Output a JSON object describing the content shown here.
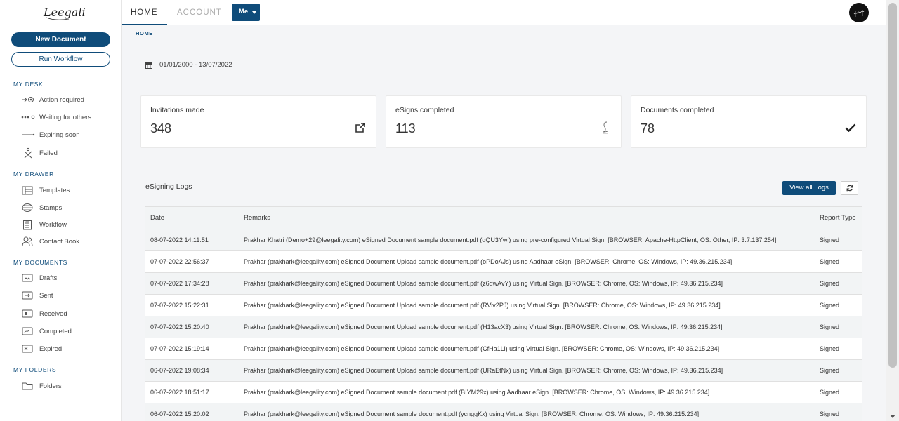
{
  "brand": {
    "logo_text": "Leegality"
  },
  "sidebar": {
    "new_document": "New Document",
    "run_workflow": "Run Workflow",
    "sections": [
      {
        "title": "MY DESK",
        "items": [
          {
            "label": "Action required",
            "icon": "action-required-icon"
          },
          {
            "label": "Waiting for others",
            "icon": "waiting-icon"
          },
          {
            "label": "Expiring soon",
            "icon": "expiring-icon"
          },
          {
            "label": "Failed",
            "icon": "failed-icon"
          }
        ]
      },
      {
        "title": "MY DRAWER",
        "items": [
          {
            "label": "Templates",
            "icon": "templates-icon"
          },
          {
            "label": "Stamps",
            "icon": "stamps-icon"
          },
          {
            "label": "Workflow",
            "icon": "workflow-icon"
          },
          {
            "label": "Contact Book",
            "icon": "contact-book-icon"
          }
        ]
      },
      {
        "title": "MY DOCUMENTS",
        "items": [
          {
            "label": "Drafts",
            "icon": "drafts-icon"
          },
          {
            "label": "Sent",
            "icon": "sent-icon"
          },
          {
            "label": "Received",
            "icon": "received-icon"
          },
          {
            "label": "Completed",
            "icon": "completed-icon"
          },
          {
            "label": "Expired",
            "icon": "expired-icon"
          }
        ]
      },
      {
        "title": "MY FOLDERS",
        "items": [
          {
            "label": "Folders",
            "icon": "folder-icon"
          }
        ]
      }
    ]
  },
  "topbar": {
    "tabs": [
      "HOME",
      "ACCOUNT"
    ],
    "me_label": "Me"
  },
  "breadcrumb": "HOME",
  "date_range": "01/01/2000 - 13/07/2022",
  "stats": [
    {
      "label": "Invitations made",
      "value": "348",
      "icon": "external-link-icon"
    },
    {
      "label": "eSigns completed",
      "value": "113",
      "icon": "signature-icon"
    },
    {
      "label": "Documents completed",
      "value": "78",
      "icon": "checkmark-icon"
    }
  ],
  "logs": {
    "title": "eSigning Logs",
    "view_all": "View all Logs",
    "columns": [
      "Date",
      "Remarks",
      "Report Type"
    ],
    "rows": [
      [
        "08-07-2022 14:11:51",
        "Prakhar Khatri (Demo+29@leegality.com) eSigned Document sample document.pdf (qQU3Ywi) using pre-configured Virtual Sign. [BROWSER: Apache-HttpClient, OS: Other, IP: 3.7.137.254]",
        "Signed"
      ],
      [
        "07-07-2022 22:56:37",
        "Prakhar (prakhark@leegality.com) eSigned Document Upload sample document.pdf (oPDoAJs) using Aadhaar eSign. [BROWSER: Chrome, OS: Windows, IP: 49.36.215.234]",
        "Signed"
      ],
      [
        "07-07-2022 17:34:28",
        "Prakhar (prakhark@leegality.com) eSigned Document Upload sample document.pdf (z6dwAvY) using Virtual Sign. [BROWSER: Chrome, OS: Windows, IP: 49.36.215.234]",
        "Signed"
      ],
      [
        "07-07-2022 15:22:31",
        "Prakhar (prakhark@leegality.com) eSigned Document Upload sample document.pdf (RViv2PJ) using Virtual Sign. [BROWSER: Chrome, OS: Windows, IP: 49.36.215.234]",
        "Signed"
      ],
      [
        "07-07-2022 15:20:40",
        "Prakhar (prakhark@leegality.com) eSigned Document Upload sample document.pdf (H13acX3) using Virtual Sign. [BROWSER: Chrome, OS: Windows, IP: 49.36.215.234]",
        "Signed"
      ],
      [
        "07-07-2022 15:19:14",
        "Prakhar (prakhark@leegality.com) eSigned Document Upload sample document.pdf (CfHa1Ll) using Virtual Sign. [BROWSER: Chrome, OS: Windows, IP: 49.36.215.234]",
        "Signed"
      ],
      [
        "06-07-2022 19:08:34",
        "Prakhar (prakhark@leegality.com) eSigned Document Upload sample document.pdf (URaEtNx) using Virtual Sign. [BROWSER: Chrome, OS: Windows, IP: 49.36.215.234]",
        "Signed"
      ],
      [
        "06-07-2022 18:51:17",
        "Prakhar (prakhark@leegality.com) eSigned Document sample document.pdf (BIYM29x) using Aadhaar eSign. [BROWSER: Chrome, OS: Windows, IP: 49.36.215.234]",
        "Signed"
      ],
      [
        "06-07-2022 15:20:02",
        "Prakhar (prakhark@leegality.com) eSigned Document sample document.pdf (ycnggKx) using Virtual Sign. [BROWSER: Chrome, OS: Windows, IP: 49.36.215.234]",
        "Signed"
      ]
    ]
  },
  "colors": {
    "primary": "#0f4c7a",
    "background": "#f4f5f7",
    "row_alt": "#f2f4f5"
  }
}
